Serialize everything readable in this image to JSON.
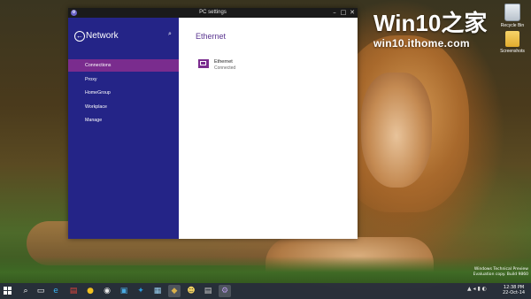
{
  "watermark": {
    "brand": "Win10之家",
    "url": "win10.ithome.com"
  },
  "desktop_icons": [
    {
      "label": "Recycle Bin",
      "icon": "recycle-bin-icon"
    },
    {
      "label": "Screenshots",
      "icon": "folder-icon"
    }
  ],
  "window": {
    "title": "PC settings",
    "controls": {
      "minimize": "–",
      "maximize": "□",
      "close": "✕"
    }
  },
  "sidebar": {
    "heading": "Network",
    "back_glyph": "←",
    "search_glyph": "⌕",
    "items": [
      {
        "label": "Connections",
        "active": true
      },
      {
        "label": "Proxy",
        "active": false
      },
      {
        "label": "HomeGroup",
        "active": false
      },
      {
        "label": "Workplace",
        "active": false
      },
      {
        "label": "Manage",
        "active": false
      }
    ]
  },
  "content": {
    "section_title": "Ethernet",
    "connection": {
      "name": "Ethernet",
      "status": "Connected"
    }
  },
  "taskbar": {
    "apps": [
      {
        "name": "search",
        "glyph": "⌕"
      },
      {
        "name": "task-view",
        "glyph": "▭"
      },
      {
        "name": "internet-explorer",
        "glyph": "e"
      },
      {
        "name": "file-explorer",
        "glyph": "▤"
      },
      {
        "name": "app",
        "glyph": "●"
      },
      {
        "name": "chrome",
        "glyph": "◉"
      },
      {
        "name": "store",
        "glyph": "▣"
      },
      {
        "name": "twitter",
        "glyph": "✦"
      },
      {
        "name": "app",
        "glyph": "▦"
      },
      {
        "name": "app",
        "glyph": "◆"
      },
      {
        "name": "app",
        "glyph": "☻"
      },
      {
        "name": "app",
        "glyph": "▤"
      },
      {
        "name": "settings",
        "glyph": "⚙"
      }
    ],
    "tray_glyphs": "▲ ◂ ▮ ◐",
    "clock_time": "12:38 PM",
    "clock_date": "22-Oct-14"
  },
  "build_info": {
    "line1": "Windows Technical Preview",
    "line2": "Evaluation copy. Build 9860"
  }
}
